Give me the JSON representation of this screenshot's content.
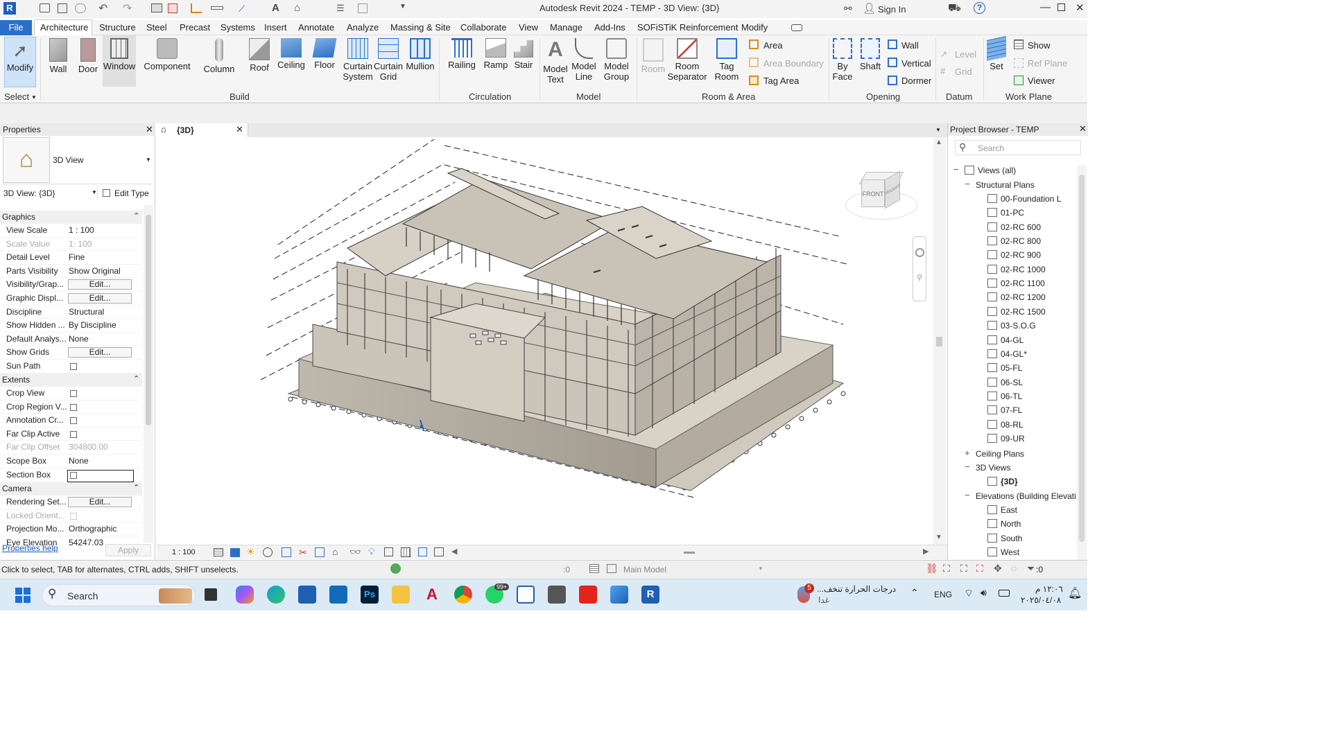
{
  "titlebar": {
    "title": "Autodesk Revit 2024 - TEMP - 3D View: {3D}",
    "sign_in": "Sign In"
  },
  "menu": {
    "tabs": [
      "File",
      "Architecture",
      "Structure",
      "Steel",
      "Precast",
      "Systems",
      "Insert",
      "Annotate",
      "Analyze",
      "Massing & Site",
      "Collaborate",
      "View",
      "Manage",
      "Add-Ins",
      "SOFiSTiK Reinforcement",
      "Modify"
    ],
    "active": "Architecture"
  },
  "ribbon": {
    "modify": "Modify",
    "select": "Select",
    "build": {
      "wall": "Wall",
      "door": "Door",
      "window": "Window",
      "component": "Component",
      "column": "Column",
      "roof": "Roof",
      "ceiling": "Ceiling",
      "floor": "Floor",
      "curtain_system": "Curtain System",
      "curtain_grid": "Curtain Grid",
      "mullion": "Mullion",
      "label": "Build"
    },
    "circulation": {
      "railing": "Railing",
      "ramp": "Ramp",
      "stair": "Stair",
      "label": "Circulation"
    },
    "model": {
      "model_text": "Model Text",
      "model_line": "Model Line",
      "model_group": "Model Group",
      "label": "Model"
    },
    "room_area": {
      "room": "Room",
      "room_separator": "Room Separator",
      "tag_room": "Tag Room",
      "area": "Area",
      "area_boundary": "Area Boundary",
      "tag_area": "Tag Area",
      "label": "Room & Area"
    },
    "opening": {
      "by_face": "By Face",
      "shaft": "Shaft",
      "wall": "Wall",
      "vertical": "Vertical",
      "dormer": "Dormer",
      "label": "Opening"
    },
    "datum": {
      "level": "Level",
      "grid": "Grid",
      "label": "Datum"
    },
    "work_plane": {
      "set": "Set",
      "show": "Show",
      "ref_plane": "Ref  Plane",
      "viewer": "Viewer",
      "label": "Work Plane"
    }
  },
  "properties": {
    "title": "Properties",
    "type_name": "3D View",
    "selector": "3D View: {3D}",
    "edit_type": "Edit Type",
    "sections": {
      "graphics": "Graphics",
      "extents": "Extents",
      "camera": "Camera"
    },
    "graphics_rows": [
      {
        "k": "View Scale",
        "v": "1 : 100"
      },
      {
        "k": "Scale Value",
        "v": "1:  100"
      },
      {
        "k": "Detail Level",
        "v": "Fine"
      },
      {
        "k": "Parts Visibility",
        "v": "Show Original"
      },
      {
        "k": "Visibility/Grap...",
        "v": "Edit..."
      },
      {
        "k": "Graphic Displ...",
        "v": "Edit..."
      },
      {
        "k": "Discipline",
        "v": "Structural"
      },
      {
        "k": "Show Hidden ...",
        "v": "By Discipline"
      },
      {
        "k": "Default Analys...",
        "v": "None"
      },
      {
        "k": "Show Grids",
        "v": "Edit..."
      },
      {
        "k": "Sun Path",
        "v": ""
      }
    ],
    "extents_rows": [
      {
        "k": "Crop View",
        "v": ""
      },
      {
        "k": "Crop Region V...",
        "v": ""
      },
      {
        "k": "Annotation Cr...",
        "v": ""
      },
      {
        "k": "Far Clip Active",
        "v": ""
      },
      {
        "k": "Far Clip Offset",
        "v": "304800.00"
      },
      {
        "k": "Scope Box",
        "v": "None"
      },
      {
        "k": "Section Box",
        "v": ""
      }
    ],
    "camera_rows": [
      {
        "k": "Rendering Set...",
        "v": "Edit..."
      },
      {
        "k": "Locked Orient...",
        "v": ""
      },
      {
        "k": "Projection Mo...",
        "v": "Orthographic"
      },
      {
        "k": "Eye Elevation",
        "v": "54247.03"
      }
    ],
    "help": "Properties help",
    "apply": "Apply"
  },
  "view": {
    "tab": "{3D}",
    "scale": "1 : 100",
    "viewcube_front": "FRONT",
    "viewcube_right": "RIGHT"
  },
  "browser": {
    "title": "Project Browser - TEMP",
    "search": "Search",
    "root": "Views (all)",
    "structural_plans": "Structural Plans",
    "plans": [
      "00-Foundation L",
      "01-PC",
      "02-RC 600",
      "02-RC 800",
      "02-RC 900",
      "02-RC 1000",
      "02-RC 1100",
      "02-RC 1200",
      "02-RC 1500",
      "03-S.O.G",
      "04-GL",
      "04-GL*",
      "05-FL",
      "06-SL",
      "06-TL",
      "07-FL",
      "08-RL",
      "09-UR"
    ],
    "ceiling_plans": "Ceiling Plans",
    "views_3d": "3D Views",
    "view_3d_item": "{3D}",
    "elevations": "Elevations (Building Elevati",
    "elevation_items": [
      "East",
      "North",
      "South",
      "West"
    ]
  },
  "status": {
    "hint": "Click to select, TAB for alternates, CTRL adds, SHIFT unselects.",
    "zero": ":0",
    "workset": "Main Model",
    "filter": ":0"
  },
  "taskbar": {
    "search": "Search",
    "weather": "درجات الحرارة تنخف...",
    "weather_sub": "غدا",
    "lang": "ENG",
    "time": "١٢:٠٦ م",
    "date": "٢٠٢٥/٠٤/٠٨",
    "notif": "5",
    "whatsapp_badge": "99+"
  },
  "colors": {
    "accent": "#1f5fb4",
    "file_tab": "#2b6fc9",
    "model": "#c9c2b6"
  }
}
